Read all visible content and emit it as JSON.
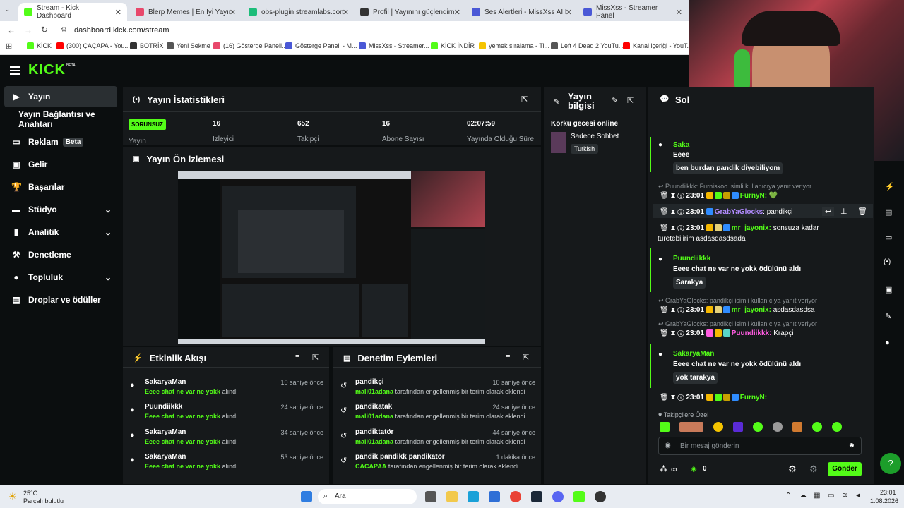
{
  "browser": {
    "tabs": [
      {
        "title": "Stream - Kick Dashboard",
        "color": "#53fc18"
      },
      {
        "title": "Blerp Memes | En İyi Yayıncı Dest...",
        "color": "#e8486b"
      },
      {
        "title": "obs-plugin.streamlabs.com/aut...",
        "color": "#1dbd7a"
      },
      {
        "title": "Profil | Yayınını güçlendirmek iç...",
        "color": "#333"
      },
      {
        "title": "Ses Alertleri - MissXss AI Bot Sys...",
        "color": "#4a58d6"
      },
      {
        "title": "MissXss - Streamer Panel",
        "color": "#4a58d6"
      }
    ],
    "url": "dashboard.kick.com/stream",
    "bookmarks": [
      {
        "label": "KİCK",
        "color": "#53fc18"
      },
      {
        "label": "(300) ÇAÇAPA - You...",
        "color": "#ff0000"
      },
      {
        "label": "BOTRİX",
        "color": "#333"
      },
      {
        "label": "Yeni Sekme",
        "color": "#555"
      },
      {
        "label": "(16) Gösterge Paneli...",
        "color": "#e8486b"
      },
      {
        "label": "Gösterge Paneli - M...",
        "color": "#4a58d6"
      },
      {
        "label": "MissXss - Streamer...",
        "color": "#4a58d6"
      },
      {
        "label": "KİCK İNDİR",
        "color": "#53fc18"
      },
      {
        "label": "yemek sıralama - Ti...",
        "color": "#f5c400"
      },
      {
        "label": "Left 4 Dead 2 YouTu...",
        "color": "#555"
      },
      {
        "label": "Kanal içeriği - YouT...",
        "color": "#ff0000"
      }
    ]
  },
  "kick": {
    "logo": "KICK",
    "beta_mark": "BETA",
    "nav": [
      {
        "label": "Yayın",
        "icon": "broadcast-icon",
        "active": true
      },
      {
        "label": "Yayın Bağlantısı ve Anahtarı",
        "icon": "",
        "active": false
      },
      {
        "label": "Reklam",
        "icon": "ad-icon",
        "badge": "Beta"
      },
      {
        "label": "Gelir",
        "icon": "revenue-icon"
      },
      {
        "label": "Başarılar",
        "icon": "trophy-icon"
      },
      {
        "label": "Stüdyo",
        "icon": "studio-icon",
        "chevron": true
      },
      {
        "label": "Analitik",
        "icon": "analytics-icon",
        "chevron": true
      },
      {
        "label": "Denetleme",
        "icon": "hammer-icon"
      },
      {
        "label": "Topluluk",
        "icon": "community-icon",
        "chevron": true
      },
      {
        "label": "Droplar ve ödüller",
        "icon": "drops-icon"
      }
    ],
    "stats": {
      "title": "Yayın İstatistikleri",
      "status": "SORUNSUZ",
      "status_label": "Yayın",
      "items": [
        {
          "value": "16",
          "label": "İzleyici"
        },
        {
          "value": "652",
          "label": "Takipçi"
        },
        {
          "value": "16",
          "label": "Abone Sayısı"
        },
        {
          "value": "02:07:59",
          "label": "Yayında Olduğu Süre"
        }
      ]
    },
    "preview": {
      "title": "Yayın Ön İzlemesi"
    },
    "info": {
      "title": "Yayın bilgisi",
      "stream_title": "Korku gecesi online",
      "category": "Sadece Sohbet",
      "language": "Turkish"
    },
    "activity": {
      "title": "Etkinlik Akışı",
      "items": [
        {
          "user": "SakaryaMan",
          "reward": "Eeee chat ne var ne yokk",
          "suffix": "alındı",
          "time": "10 saniye önce"
        },
        {
          "user": "Puundiikkk",
          "reward": "Eeee chat ne var ne yokk",
          "suffix": "alındı",
          "time": "24 saniye önce"
        },
        {
          "user": "SakaryaMan",
          "reward": "Eeee chat ne var ne yokk",
          "suffix": "alındı",
          "time": "34 saniye önce"
        },
        {
          "user": "SakaryaMan",
          "reward": "Eeee chat ne var ne yokk",
          "suffix": "alındı",
          "time": "53 saniye önce"
        }
      ]
    },
    "moderation": {
      "title": "Denetim Eylemleri",
      "items": [
        {
          "term": "pandikçi",
          "mod": "mali01adana",
          "text": "tarafından engellenmiş bir terim olarak eklendi",
          "time": "10 saniye önce"
        },
        {
          "term": "pandikatak",
          "mod": "mali01adana",
          "text": "tarafından engellenmiş bir terim olarak eklendi",
          "time": "24 saniye önce"
        },
        {
          "term": "pandiktatör",
          "mod": "mali01adana",
          "text": "tarafından engellenmiş bir terim olarak eklendi",
          "time": "44 saniye önce"
        },
        {
          "term": "pandik pandikk pandikatör",
          "mod": "CACAPAA",
          "text": "tarafından engellenmiş bir terim olarak eklendi",
          "time": "1 dakika önce"
        }
      ]
    },
    "chat": {
      "title": "Sol",
      "messages": [
        {
          "type": "reward",
          "user": "Saka",
          "line": "Eeee",
          "quote": "ben burdan pandik diyebiliyom"
        },
        {
          "type": "reply_header",
          "text": "Puundiikkk: Furniskoo isimli kullanıcıya yanıt veriyor"
        },
        {
          "type": "msg",
          "time": "23:01",
          "user": "FurnyN:",
          "user_color": "#53fc18",
          "text": "💚"
        },
        {
          "type": "msg",
          "time": "23:01",
          "user": "GrabYaGlocks",
          "user_color": "#b28cff",
          "text": ": pandikçi"
        },
        {
          "type": "msg",
          "time": "23:01",
          "user": "mr_jayonix:",
          "user_color": "#53fc18",
          "text": "sonsuza kadar",
          "text2": "türetebilirim asdasdasdsada"
        },
        {
          "type": "reward",
          "user": "Puundiikkk",
          "line": "Eeee chat ne var ne yokk ödülünü aldı",
          "quote": "Sarakya"
        },
        {
          "type": "reply_header",
          "text": "GrabYaGlocks: pandikçi isimli kullanıcıya yanıt veriyor"
        },
        {
          "type": "msg",
          "time": "23:01",
          "user": "mr_jayonix:",
          "user_color": "#53fc18",
          "text": "asdasdasdsa"
        },
        {
          "type": "reply_header",
          "text": "GrabYaGlocks: pandikçi isimli kullanıcıya yanıt veriyor"
        },
        {
          "type": "msg",
          "time": "23:01",
          "user": "Puundiikkk:",
          "user_color": "#ff5ce1",
          "text": "Krapçi"
        },
        {
          "type": "reward",
          "user": "SakaryaMan",
          "line": "Eeee chat ne var ne yokk ödülünü aldı",
          "quote": "yok tarakya"
        },
        {
          "type": "msg",
          "time": "23:01",
          "user": "FurnyN:",
          "user_color": "#53fc18",
          "text": ""
        }
      ],
      "follower_label": "Takipçilere Özel",
      "input_placeholder": "Bir mesaj gönderin",
      "points": "∞",
      "coins": "0",
      "send": "Gönder"
    }
  },
  "taskbar": {
    "weather_temp": "25°C",
    "weather_desc": "Parçalı bulutlu",
    "search": "Ara",
    "time": "23:01",
    "date": "1.08.2026"
  }
}
